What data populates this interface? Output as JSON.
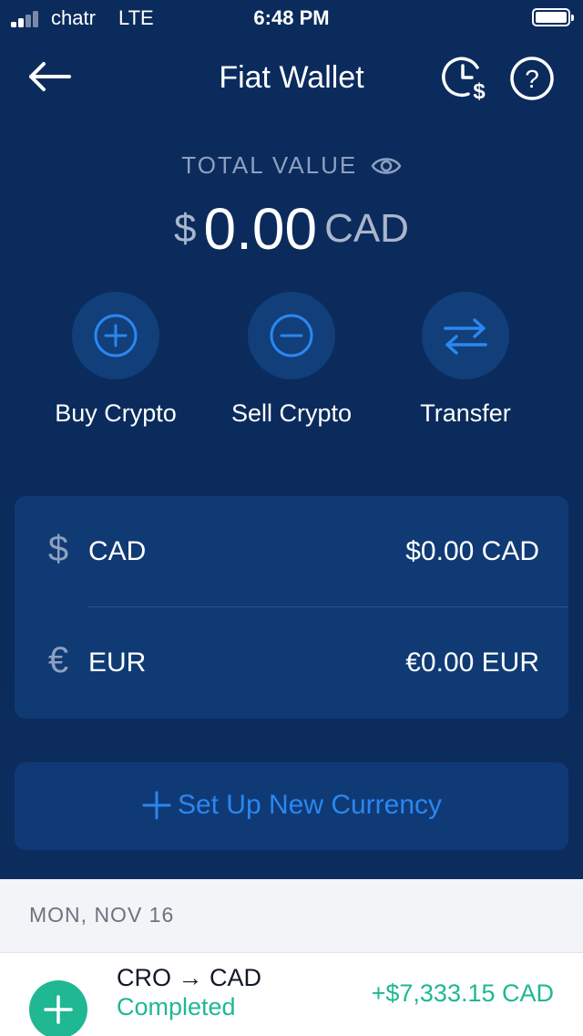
{
  "status_bar": {
    "carrier": "chatr",
    "network": "LTE",
    "time": "6:48 PM"
  },
  "header": {
    "title": "Fiat Wallet",
    "back_icon": "arrow-left-icon",
    "history_icon": "clock-dollar-icon",
    "help_icon": "question-icon"
  },
  "total": {
    "label": "TOTAL VALUE",
    "symbol": "$",
    "value": "0.00",
    "currency": "CAD",
    "visibility_icon": "eye-icon"
  },
  "actions": [
    {
      "label": "Buy Crypto",
      "icon": "plus-circle-icon"
    },
    {
      "label": "Sell Crypto",
      "icon": "minus-circle-icon"
    },
    {
      "label": "Transfer",
      "icon": "swap-arrows-icon"
    }
  ],
  "wallets": [
    {
      "symbol": "$",
      "code": "CAD",
      "amount": "$0.00 CAD"
    },
    {
      "symbol": "€",
      "code": "EUR",
      "amount": "€0.00 EUR"
    }
  ],
  "setup": {
    "label": "Set Up New Currency",
    "icon": "plus-icon"
  },
  "transactions": {
    "date": "MON, NOV 16",
    "items": [
      {
        "pair": "CRO → CAD",
        "status": "Completed",
        "amount": "+$7,333.15 CAD",
        "icon": "plus-icon"
      }
    ]
  },
  "colors": {
    "background": "#0b2b5c",
    "card": "#0f3a74",
    "accent_blue": "#2a87f0",
    "success_green": "#1fb893"
  }
}
